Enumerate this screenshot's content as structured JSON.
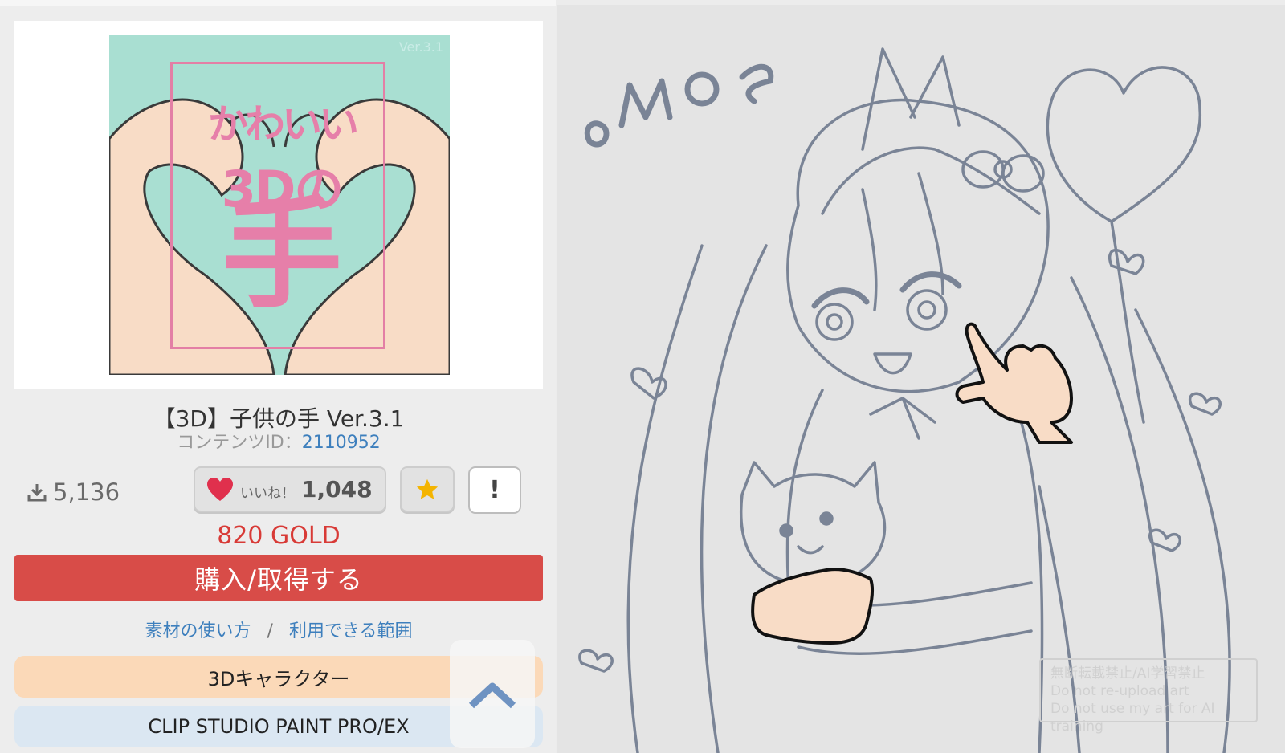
{
  "product": {
    "thumbnail": {
      "version_text": "Ver.3.1",
      "text_line1": "かわいい",
      "text_line2": "3Dの",
      "text_line3": "手"
    },
    "title": "【3D】子供の手 Ver.3.1",
    "content_id_label": "コンテンツID：",
    "content_id": "2110952",
    "downloads": "5,136",
    "like_label": "いいね！",
    "like_count": "1,048",
    "report_label": "!",
    "price": "820 GOLD",
    "buy_label": "購入/取得する",
    "link_usage": "素材の使い方",
    "link_separator": "/",
    "link_scope": "利用できる範囲",
    "tag_category": "3Dキャラクター",
    "tag_software": "CLIP STUDIO PAINT PRO/EX"
  },
  "artwork": {
    "signature": ".moe",
    "watermark_line1": "無断転載禁止/AI学習禁止",
    "watermark_line2": "Do not re-upload art",
    "watermark_line3": "Do not use my art for AI training"
  },
  "colors": {
    "price": "#d83a36",
    "buy_button": "#d84c48",
    "link": "#3d7fbd",
    "tag_category_bg": "#fbd9b8",
    "tag_software_bg": "#dbe7f2",
    "line_art": "#7a8496"
  },
  "icons": {
    "download": "download-icon",
    "like": "heart-icon",
    "favorite": "star-icon",
    "scroll_top": "chevron-up-icon"
  }
}
